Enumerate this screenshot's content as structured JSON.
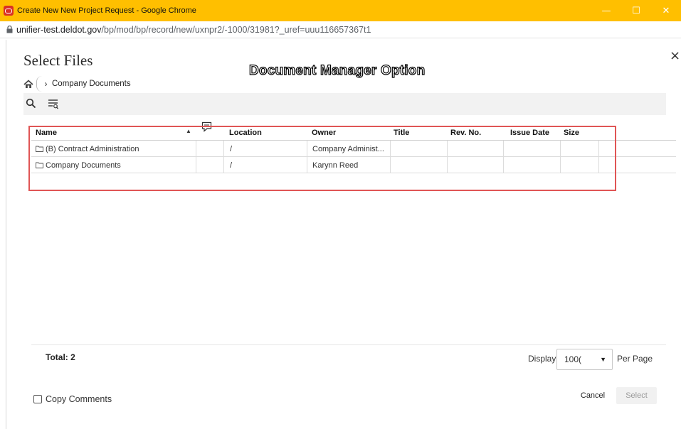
{
  "window": {
    "title": "Create New New Project Request - Google Chrome",
    "controls": {
      "minimize": "—",
      "maximize": "☐",
      "close": "✕"
    }
  },
  "address": {
    "host": "unifier-test.deldot.gov",
    "path": "/bp/mod/bp/record/new/uxnpr2/-1000/31981?_uref=uuu116657367t1"
  },
  "dialog": {
    "title": "Select Files",
    "close": "×",
    "overlay_label": "Document Manager Option"
  },
  "breadcrumb": {
    "separator": "›",
    "current": "Company Documents"
  },
  "grid": {
    "columns": [
      "Name",
      "Location",
      "Owner",
      "Title",
      "Rev. No.",
      "Issue Date",
      "Size"
    ],
    "sort_indicator": "▲",
    "rows": [
      {
        "name": "(B) Contract Administration",
        "location": "/",
        "owner": "Company Administ...",
        "title": "",
        "rev": "",
        "issue_date": "",
        "size": ""
      },
      {
        "name": "Company Documents",
        "location": "/",
        "owner": "Karynn Reed",
        "title": "",
        "rev": "",
        "issue_date": "",
        "size": ""
      }
    ]
  },
  "footer": {
    "total": "Total: 2",
    "display_label": "Display",
    "display_value": "100(",
    "per_page_label": "Per Page",
    "caret": "▼"
  },
  "actions": {
    "copy_comments": "Copy Comments",
    "copy_comments_checked": false,
    "cancel": "Cancel",
    "select": "Select"
  },
  "colors": {
    "titlebar": "#ffbf00",
    "highlight_box": "#e05555"
  }
}
